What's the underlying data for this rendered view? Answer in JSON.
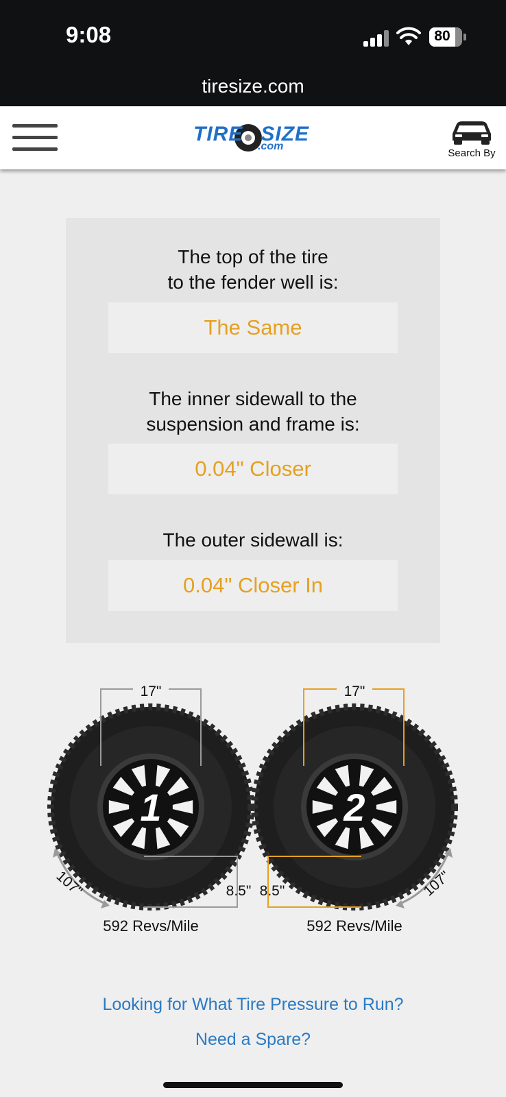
{
  "status_bar": {
    "time": "9:08",
    "battery": "80",
    "url": "tiresize.com"
  },
  "header": {
    "logo_text_left": "TIRE",
    "logo_text_right": "SIZE",
    "logo_com": ".com",
    "search_by_label": "Search By",
    "icons": [
      "hamburger-menu-icon",
      "car-icon"
    ]
  },
  "comparison": {
    "q1": [
      "The top of the tire",
      "to the fender well is:"
    ],
    "a1": "The Same",
    "q2": [
      "The inner sidewall to the",
      "suspension and frame is:"
    ],
    "a2": "0.04\" Closer",
    "q3": "The outer sidewall is:",
    "a3": "0.04\" Closer In"
  },
  "tires": [
    {
      "number": "1",
      "wheel_dia": "17\"",
      "sidewall": "8.5\"",
      "circumference": "107\"",
      "revs": "592 Revs/Mile",
      "accent": "#9a9a9a"
    },
    {
      "number": "2",
      "wheel_dia": "17\"",
      "sidewall": "8.5\"",
      "circumference": "107\"",
      "revs": "592 Revs/Mile",
      "accent": "#e6a021"
    }
  ],
  "links": {
    "pressure": "Looking for What Tire Pressure to Run?",
    "spare": "Need a Spare?"
  },
  "colors": {
    "answer": "#e6a021",
    "link": "#2a7ac4",
    "status_bar": "#0f1113"
  }
}
